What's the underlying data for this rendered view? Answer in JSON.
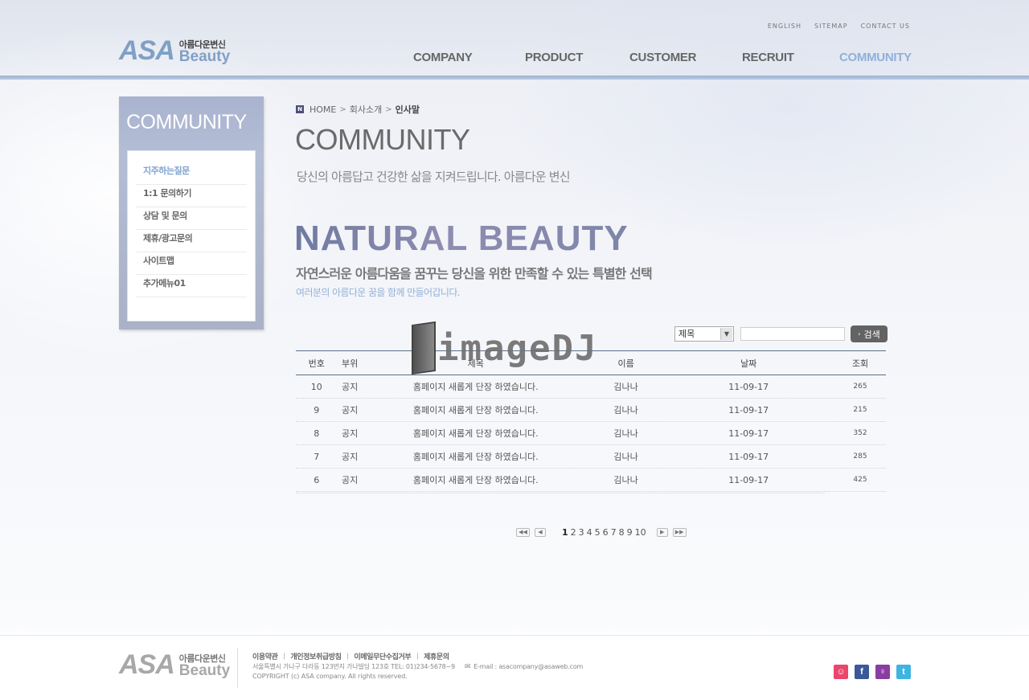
{
  "header": {
    "utility": [
      "ENGLISH",
      "SITEMAP",
      "CONTACT US"
    ],
    "logo": {
      "asa": "ASA",
      "kor": "아름다운변신",
      "beauty": "Beauty"
    },
    "nav": [
      {
        "label": "COMPANY",
        "active": false
      },
      {
        "label": "PRODUCT",
        "active": false
      },
      {
        "label": "CUSTOMER",
        "active": false
      },
      {
        "label": "RECRUIT",
        "active": false
      },
      {
        "label": "COMMUNITY",
        "active": true
      }
    ]
  },
  "sidebar": {
    "title": "COMMUNITY",
    "items": [
      {
        "label": "지주하는질문",
        "active": true
      },
      {
        "label": "1:1 문의하기",
        "active": false
      },
      {
        "label": "상담 및 문의",
        "active": false
      },
      {
        "label": "제휴/광고문의",
        "active": false
      },
      {
        "label": "사이트맵",
        "active": false
      },
      {
        "label": "추가메뉴01",
        "active": false
      }
    ]
  },
  "breadcrumb": {
    "icon": "N",
    "home": "HOME",
    "level1": "회사소개",
    "current": "인사말"
  },
  "content": {
    "title": "COMMUNITY",
    "subtitle": "당신의 아름답고 건강한 삶을 지켜드립니다. 아름다운 변신",
    "banner_title": "NATURAL BEAUTY",
    "banner_sub1": "자연스러운 아름다움을 꿈꾸는 당신을 위한 만족할 수 있는 특별한 선택",
    "banner_sub2": "여러분의 아름다운 꿈을 함께 만들어갑니다."
  },
  "search": {
    "select_value": "제목",
    "input_value": "",
    "button_label": "검색"
  },
  "table": {
    "headers": {
      "no": "번호",
      "part": "부위",
      "title": "제목",
      "name": "이름",
      "date": "날짜",
      "views": "조회"
    },
    "rows": [
      {
        "no": "10",
        "part": "공지",
        "title": "홈페이지 새롭게 단장 하였습니다.",
        "name": "김나나",
        "date": "11-09-17",
        "views": "265"
      },
      {
        "no": "9",
        "part": "공지",
        "title": "홈페이지 새롭게 단장 하였습니다.",
        "name": "김나나",
        "date": "11-09-17",
        "views": "215"
      },
      {
        "no": "8",
        "part": "공지",
        "title": "홈페이지 새롭게 단장 하였습니다.",
        "name": "김나나",
        "date": "11-09-17",
        "views": "352"
      },
      {
        "no": "7",
        "part": "공지",
        "title": "홈페이지 새롭게 단장 하였습니다.",
        "name": "김나나",
        "date": "11-09-17",
        "views": "285"
      },
      {
        "no": "6",
        "part": "공지",
        "title": "홈페이지 새롭게 단장 하였습니다.",
        "name": "김나나",
        "date": "11-09-17",
        "views": "425"
      }
    ]
  },
  "pagination": {
    "pages": [
      "1",
      "2",
      "3",
      "4",
      "5",
      "6",
      "7",
      "8",
      "9",
      "10"
    ],
    "current": "1"
  },
  "watermark": "imageDJ",
  "footer": {
    "links": [
      "이용약관",
      "개인정보취급방침",
      "이메일무단수집거부",
      "제휴문의"
    ],
    "address": "서울특별시 가나구 다라동 123번지 가나빌딩 123호 TEL: 01)234-5678~9",
    "email": "E-mail : asacompany@asaweb.com",
    "copyright": "COPYRIGHT (c) ASA company. All rights reserved.",
    "sns": [
      {
        "icon": "cyworld-icon",
        "glyph": "☺",
        "color": "#e8466b"
      },
      {
        "icon": "facebook-icon",
        "glyph": "f",
        "color": "#3b5998"
      },
      {
        "icon": "me2day-icon",
        "glyph": "♀",
        "color": "#8a3fa0"
      },
      {
        "icon": "twitter-icon",
        "glyph": "t",
        "color": "#3fb4e0"
      }
    ]
  }
}
